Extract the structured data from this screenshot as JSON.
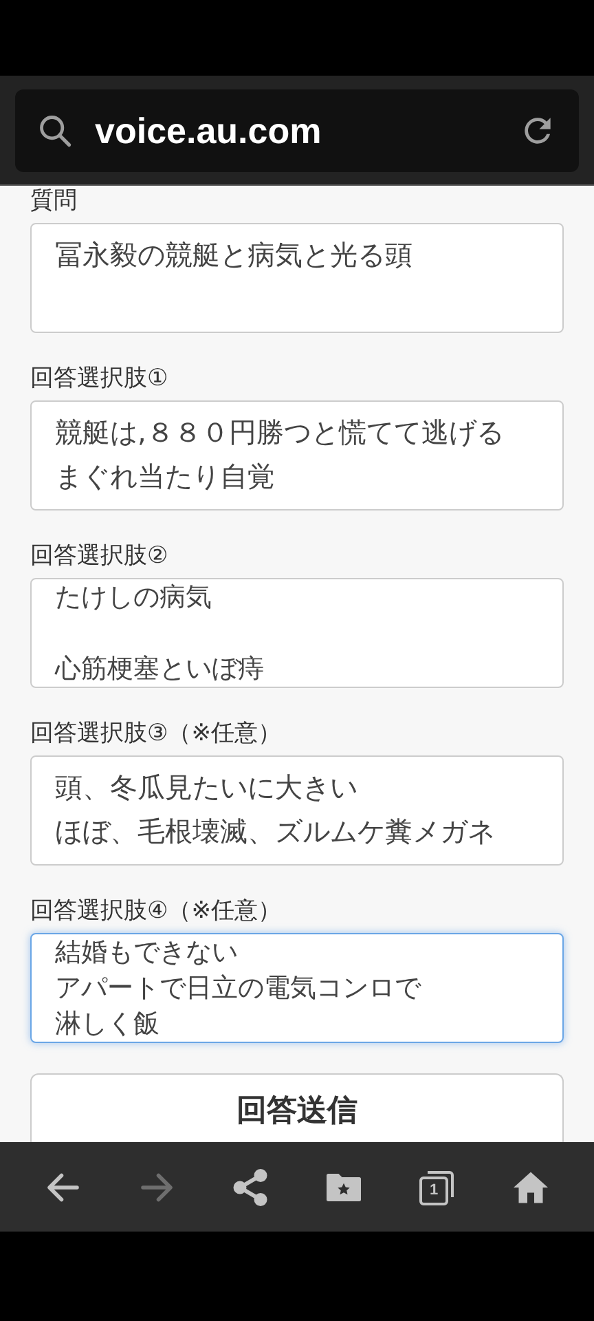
{
  "address_bar": {
    "url": "voice.au.com"
  },
  "fields": [
    {
      "label": "質問",
      "lines": [
        "冨永毅の競艇と病気と光る頭"
      ],
      "scrolled": false,
      "focused": false
    },
    {
      "label": "回答選択肢①",
      "lines": [
        "競艇は,８８０円勝つと慌てて逃げる",
        "まぐれ当たり自覚"
      ],
      "spaced": false,
      "scrolled": false,
      "focused": false
    },
    {
      "label": "回答選択肢②",
      "lines": [
        "たけしの病気",
        "心筋梗塞といぼ痔"
      ],
      "spaced": true,
      "scrolled": true,
      "focused": false
    },
    {
      "label": "回答選択肢③（※任意）",
      "lines": [
        "頭、冬瓜見たいに大きい",
        "ほぼ、毛根壊滅、ズルムケ糞メガネ"
      ],
      "spaced": false,
      "scrolled": false,
      "focused": false
    },
    {
      "label": "回答選択肢④（※任意）",
      "lines": [
        "結婚もできない",
        "アパートで日立の電気コンロで",
        "淋しく飯"
      ],
      "spaced": false,
      "scrolled": true,
      "focused": true
    }
  ],
  "submit_button": "回答送信",
  "nav_bar": [
    {
      "kind": "back",
      "disabled": false
    },
    {
      "kind": "forward",
      "disabled": true
    },
    {
      "kind": "share",
      "disabled": false
    },
    {
      "kind": "bookmarks",
      "disabled": false
    },
    {
      "kind": "tabs",
      "disabled": false,
      "count": "1"
    },
    {
      "kind": "home",
      "disabled": false
    }
  ]
}
